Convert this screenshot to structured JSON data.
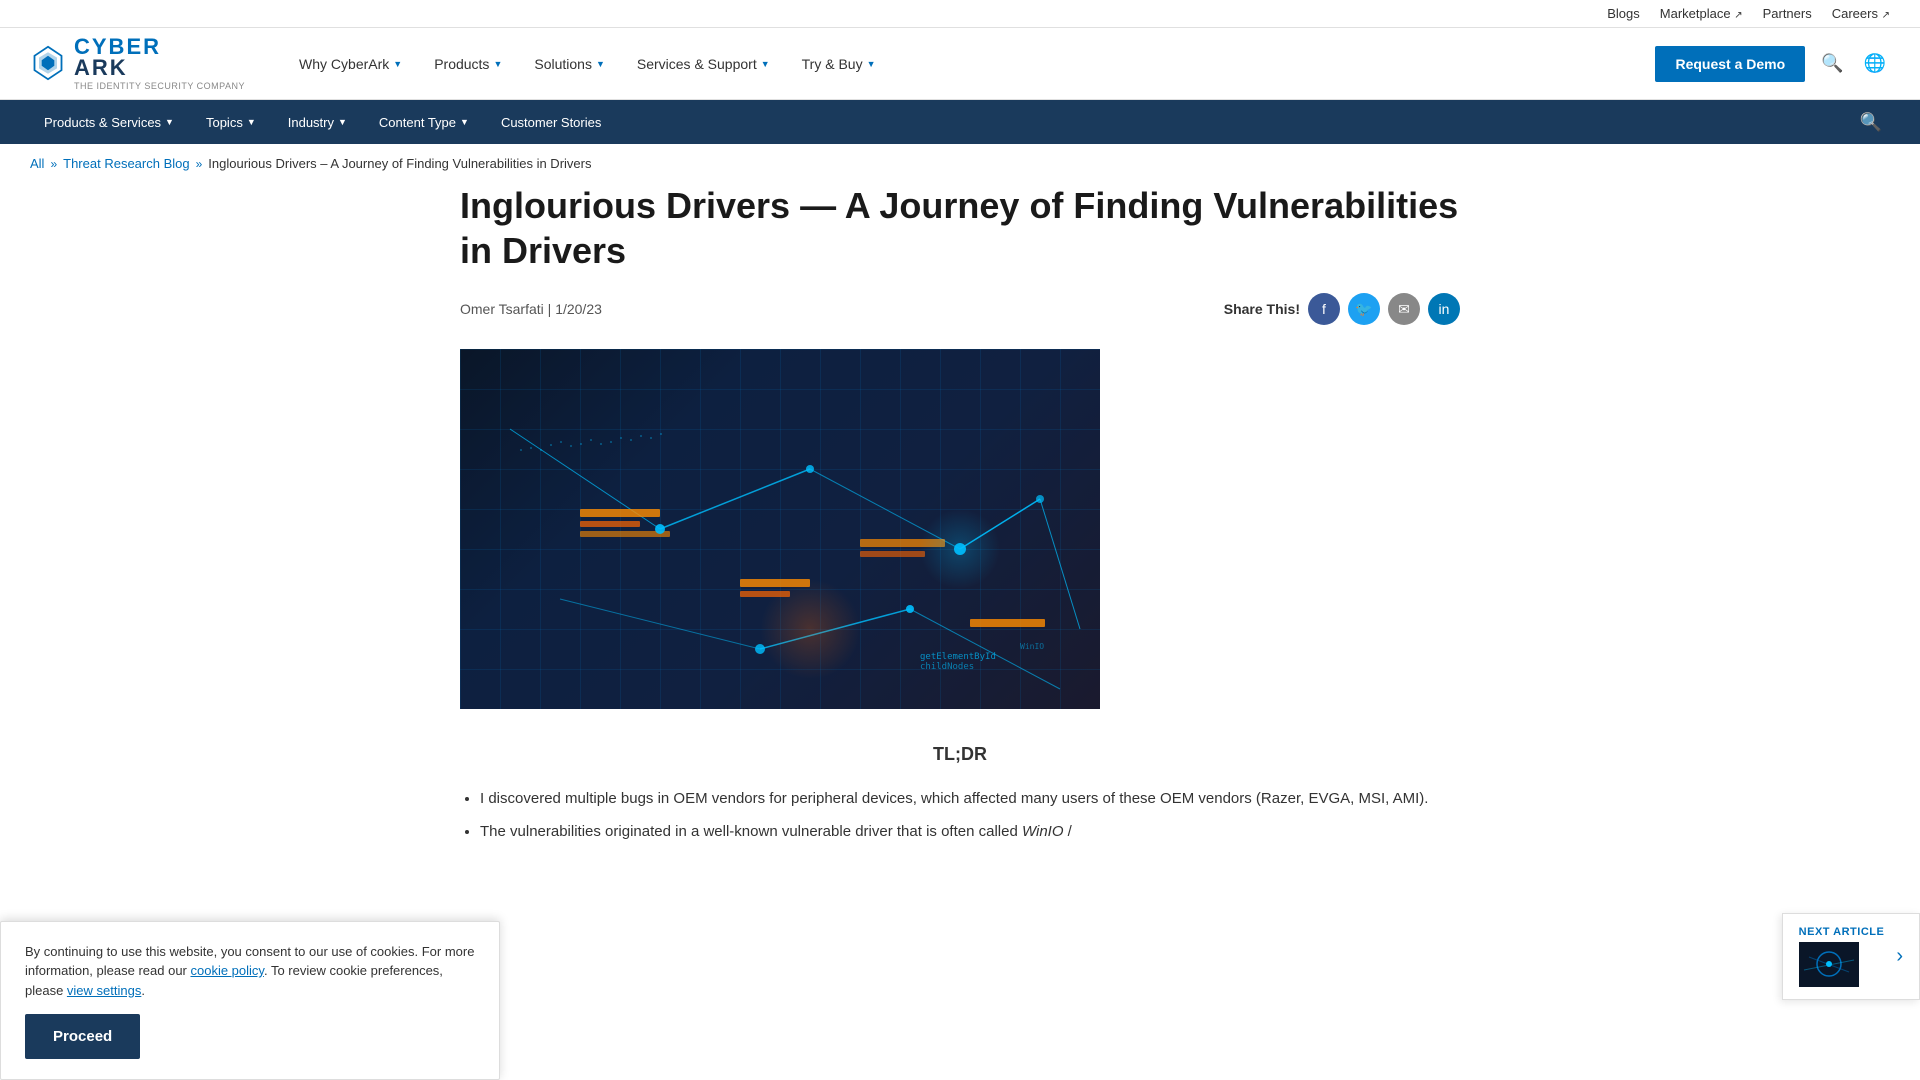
{
  "topbar": {
    "links": [
      {
        "label": "Blogs",
        "external": false
      },
      {
        "label": "Marketplace",
        "external": true
      },
      {
        "label": "Partners",
        "external": false
      },
      {
        "label": "Careers",
        "external": true
      }
    ]
  },
  "mainnav": {
    "logo_company": "CYBERARK",
    "logo_tagline": "The Identity Security Company",
    "items": [
      {
        "label": "Why CyberArk",
        "has_dropdown": true
      },
      {
        "label": "Products",
        "has_dropdown": true
      },
      {
        "label": "Solutions",
        "has_dropdown": true
      },
      {
        "label": "Services & Support",
        "has_dropdown": true
      },
      {
        "label": "Try & Buy",
        "has_dropdown": true
      }
    ],
    "demo_button": "Request a Demo"
  },
  "secondarynav": {
    "items": [
      {
        "label": "Products & Services",
        "has_dropdown": true
      },
      {
        "label": "Topics",
        "has_dropdown": true
      },
      {
        "label": "Industry",
        "has_dropdown": true
      },
      {
        "label": "Content Type",
        "has_dropdown": true
      },
      {
        "label": "Customer Stories",
        "has_dropdown": false
      }
    ]
  },
  "breadcrumb": {
    "all": "All",
    "separator": "»",
    "section": "Threat Research Blog",
    "separator2": "»",
    "current": "Inglourious Drivers – A Journey of Finding Vulnerabilities in Drivers"
  },
  "article": {
    "title": "Inglourious Drivers — A Journey of Finding Vulnerabilities in Drivers",
    "author": "Omer Tsarfati",
    "date": "1/20/23",
    "share_label": "Share This!",
    "tldr_heading": "TL;DR",
    "content_line1": "I discovered multiple bugs in OEM vendors for peripheral devices, which affected many users of these OEM vendors (Razer, EVGA, MSI, AMI).",
    "content_line2": "The vulnerabilities originated in a well-known vulnerable driver that is often called WinIO /"
  },
  "share_buttons": [
    {
      "name": "facebook",
      "label": "f"
    },
    {
      "name": "twitter",
      "label": "t"
    },
    {
      "name": "email",
      "label": "✉"
    },
    {
      "name": "linkedin",
      "label": "in"
    }
  ],
  "cookie": {
    "text_before_link": "By continuing to use this website, you consent to our use of cookies. For more information, please read our ",
    "link_text": "cookie policy",
    "text_after_link": ". To review cookie preferences, please ",
    "settings_link": "view settings",
    "text_end": ".",
    "button_label": "Proceed"
  },
  "next_article": {
    "label": "NEXT ARTICLE"
  }
}
